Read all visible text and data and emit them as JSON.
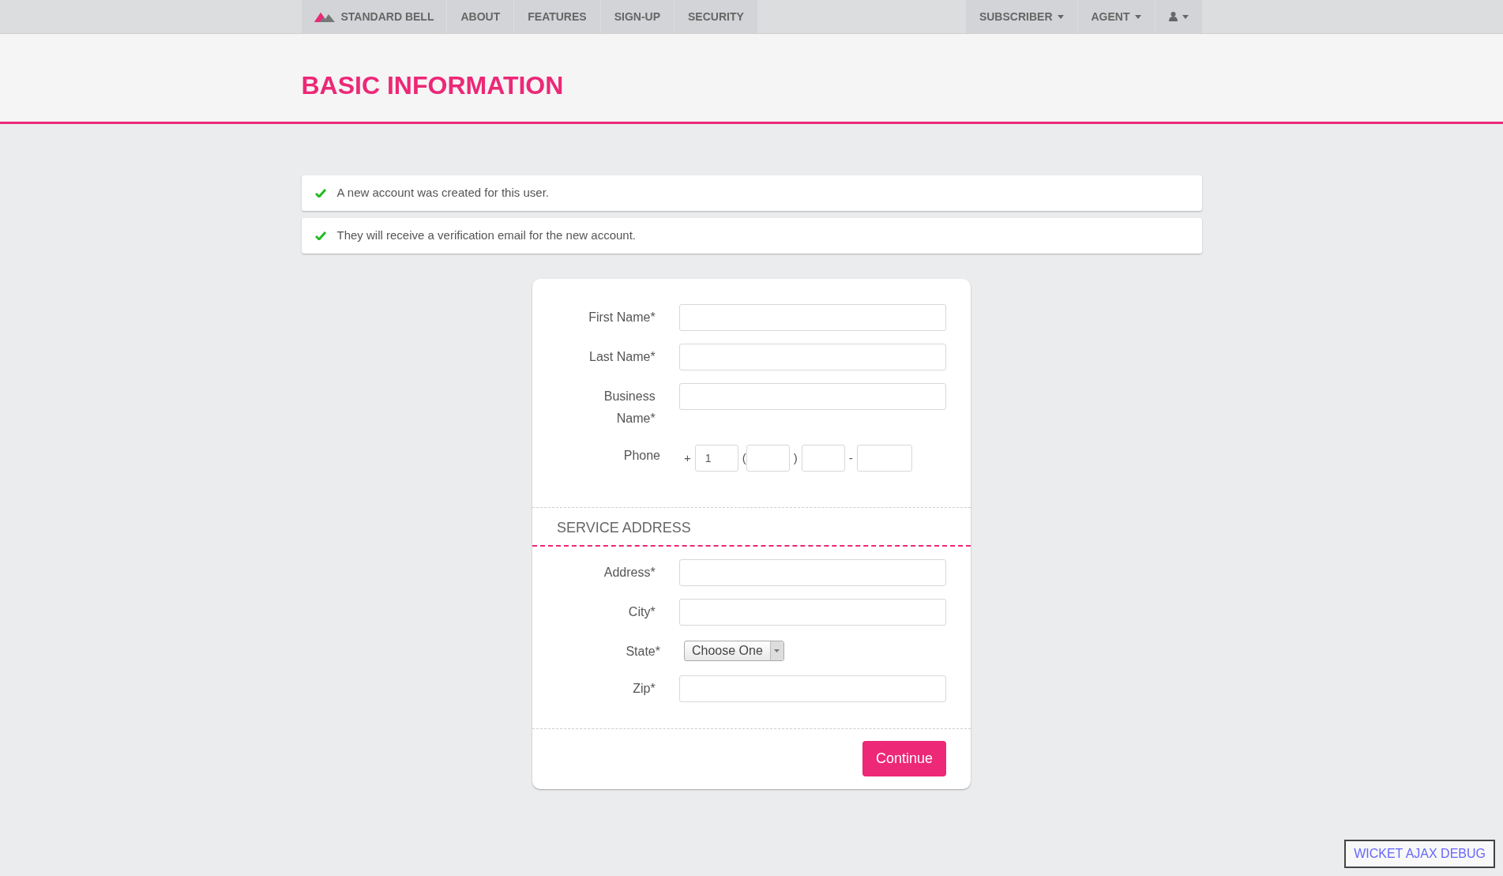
{
  "navbar": {
    "brand": "STANDARD BELL",
    "left_items": [
      {
        "label": "ABOUT"
      },
      {
        "label": "FEATURES"
      },
      {
        "label": "SIGN-UP"
      },
      {
        "label": "SECURITY"
      }
    ],
    "right_items": [
      {
        "kind": "text",
        "label": "SUBSCRIBER"
      },
      {
        "kind": "text",
        "label": "AGENT"
      },
      {
        "kind": "user"
      }
    ]
  },
  "page_title": "BASIC INFORMATION",
  "alerts": [
    {
      "text": "A new account was created for this user."
    },
    {
      "text": "They will receive a verification email for the new account."
    }
  ],
  "form": {
    "sections": [
      {
        "fields": [
          {
            "kind": "text",
            "label": "First Name*"
          },
          {
            "kind": "text",
            "label": "Last Name*"
          },
          {
            "kind": "text",
            "label": "Business Name*"
          },
          {
            "kind": "phone",
            "label": "Phone",
            "plus": "+",
            "country_code": "1",
            "open_paren": "(",
            "close_paren": ")",
            "dash": "-"
          }
        ]
      },
      {
        "heading": "SERVICE ADDRESS",
        "fields": [
          {
            "kind": "text",
            "label": "Address*"
          },
          {
            "kind": "text",
            "label": "City*"
          },
          {
            "kind": "select",
            "label": "State*",
            "value": "Choose One"
          },
          {
            "kind": "text",
            "label": "Zip*"
          }
        ]
      }
    ],
    "submit": "Continue"
  },
  "debug_link": "WICKET AJAX DEBUG"
}
